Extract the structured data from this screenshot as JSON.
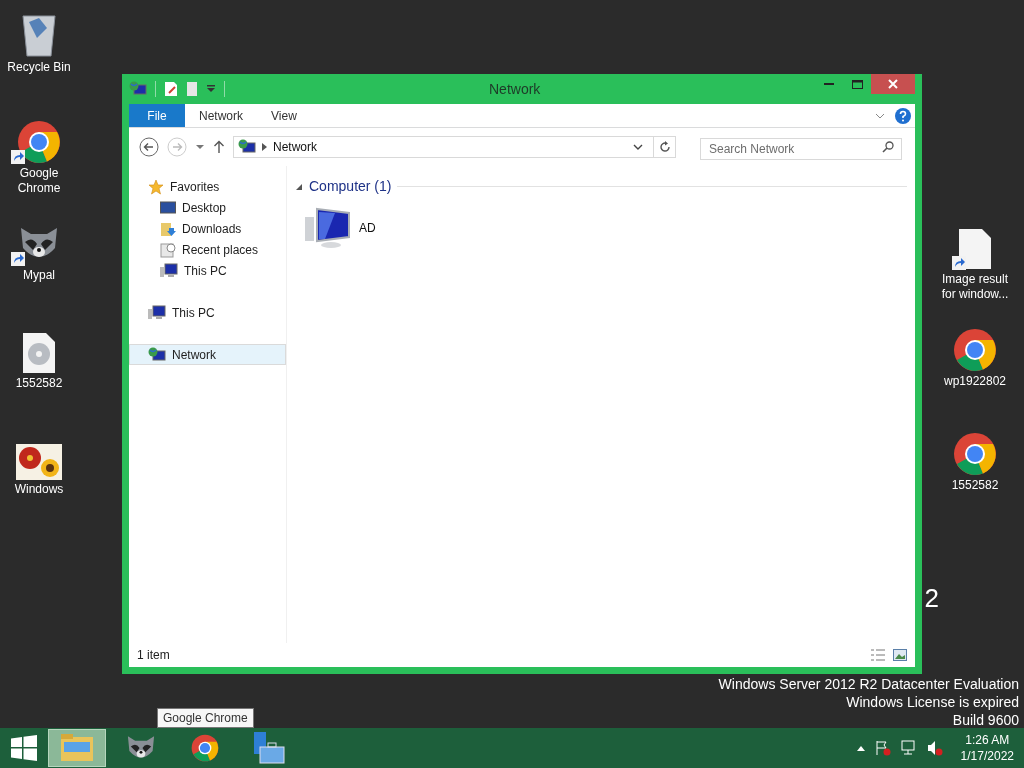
{
  "desktop_icons": [
    {
      "label": "Recycle Bin",
      "kind": "bin",
      "shortcut": false
    },
    {
      "label": "Google Chrome",
      "kind": "chrome",
      "shortcut": true
    },
    {
      "label": "Mypal",
      "kind": "raccoon",
      "shortcut": true
    },
    {
      "label": "1552582",
      "kind": "disc",
      "shortcut": false
    },
    {
      "label": "Windows",
      "kind": "photo",
      "shortcut": false
    },
    {
      "label": "Image result for window...",
      "kind": "file",
      "shortcut": true
    },
    {
      "label": "wp1922802",
      "kind": "chrome",
      "shortcut": false
    },
    {
      "label": "1552582",
      "kind": "chrome",
      "shortcut": false
    }
  ],
  "watermark": {
    "edition": "2",
    "lines": [
      "Windows Server 2012 R2 Datacenter Evaluation",
      "Windows License is expired",
      "Build 9600"
    ]
  },
  "window": {
    "title": "Network",
    "ribbon_tabs": [
      {
        "label": "File",
        "kind": "file"
      },
      {
        "label": "Network",
        "kind": "tab"
      },
      {
        "label": "View",
        "kind": "tab"
      }
    ],
    "address": {
      "path": "Network"
    },
    "search": {
      "placeholder": "Search Network"
    },
    "nav": [
      {
        "label": "Favorites",
        "kind": "star",
        "selected": false,
        "children": [
          {
            "label": "Desktop",
            "kind": "desktop",
            "selected": false
          },
          {
            "label": "Downloads",
            "kind": "downloads",
            "selected": false
          },
          {
            "label": "Recent places",
            "kind": "recent",
            "selected": false
          },
          {
            "label": "This PC",
            "kind": "pc",
            "selected": false
          }
        ]
      },
      {
        "label": "This PC",
        "kind": "pc",
        "selected": false
      },
      {
        "label": "Network",
        "kind": "network",
        "selected": true
      }
    ],
    "group": {
      "title": "Computer (1)",
      "expanded": true,
      "items": [
        {
          "label": "AD"
        }
      ]
    },
    "status": "1 item"
  },
  "tooltip": "Google Chrome",
  "taskbar": {
    "items": [
      {
        "kind": "explorer",
        "selected": true
      },
      {
        "kind": "raccoon",
        "selected": false
      },
      {
        "kind": "chrome",
        "selected": false
      },
      {
        "kind": "server",
        "selected": false
      }
    ],
    "time": "1:26 AM",
    "date": "1/17/2022"
  }
}
